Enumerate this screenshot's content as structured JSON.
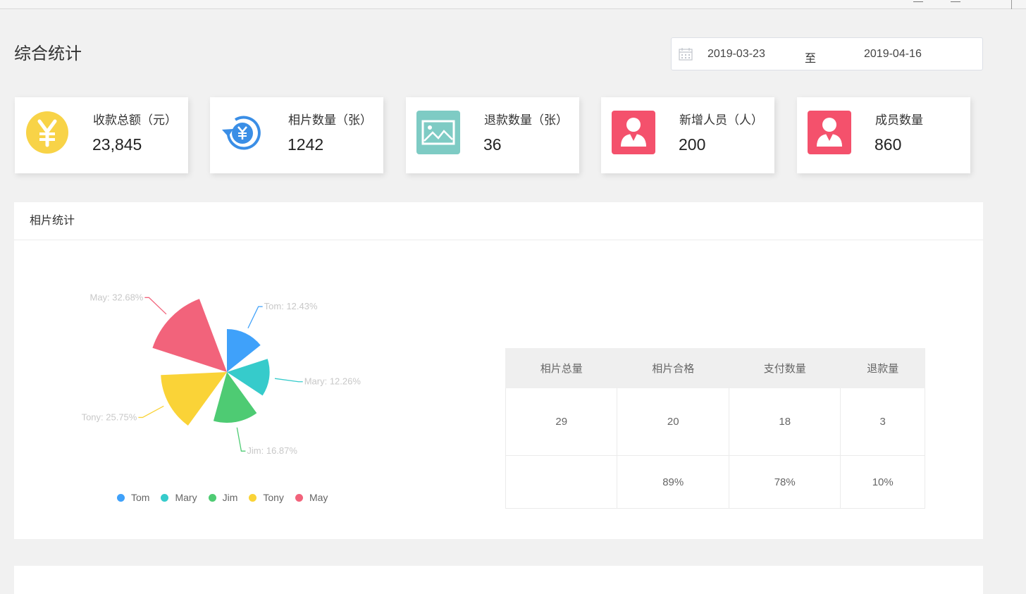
{
  "page": {
    "title": "综合统计",
    "date_range": {
      "start": "2019-03-23",
      "separator": "至",
      "end": "2019-04-16"
    }
  },
  "stats": [
    {
      "label": "收款总额（元）",
      "value": "23,845",
      "icon": "yen-coin-icon",
      "color": "#f8d347"
    },
    {
      "label": "相片数量（张）",
      "value": "1242",
      "icon": "refund-cycle-icon",
      "color": "#3a8ee6"
    },
    {
      "label": "退款数量（张）",
      "value": "36",
      "icon": "picture-icon",
      "color": "#7ecbc4"
    },
    {
      "label": "新增人员（人）",
      "value": "200",
      "icon": "user-icon",
      "color": "#f4516c"
    },
    {
      "label": "成员数量",
      "value": "860",
      "icon": "user-icon",
      "color": "#f4516c"
    }
  ],
  "photo_panel": {
    "title": "相片统计",
    "table": {
      "headers": [
        "相片总量",
        "相片合格",
        "支付数量",
        "退款量"
      ],
      "rows": [
        [
          "29",
          "20",
          "18",
          "3"
        ],
        [
          "",
          "89%",
          "78%",
          "10%"
        ]
      ]
    }
  },
  "bottom_panel": {
    "title": ""
  },
  "chart_data": {
    "type": "pie",
    "variant": "rose",
    "labels": [
      "Tom",
      "Mary",
      "Jim",
      "Tony",
      "May"
    ],
    "values": [
      12.43,
      12.26,
      16.87,
      25.75,
      32.68
    ],
    "value_labels": [
      "Tom: 12.43%",
      "Mary: 12.26%",
      "Jim: 16.87%",
      "Tony: 25.75%",
      "May: 32.68%"
    ],
    "colors": [
      "#3fa1fa",
      "#36cbcb",
      "#4ecb73",
      "#fad337",
      "#f2637b"
    ],
    "legend_position": "bottom"
  }
}
